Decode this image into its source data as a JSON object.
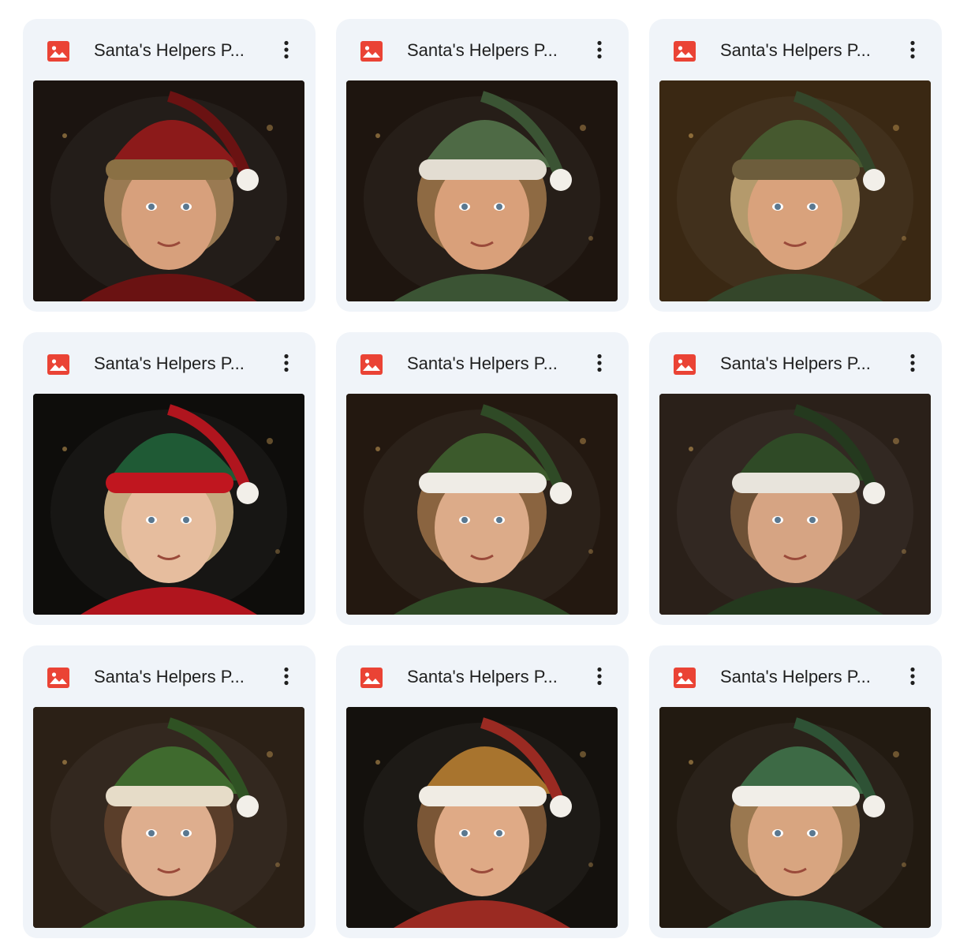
{
  "files": [
    {
      "name": "Santa's Helpers P...",
      "type_icon": "image-file-icon",
      "menu_icon": "more-vert-icon",
      "thumbnail": "santa-with-girl",
      "bg": "#1b1410",
      "hat": "#8c1a1a",
      "hat2": "#6a1212",
      "trim": "#8a7044",
      "hair": "#9a7a52",
      "skin": "#d7a07c"
    },
    {
      "name": "Santa's Helpers P...",
      "type_icon": "image-file-icon",
      "menu_icon": "more-vert-icon",
      "thumbnail": "elf-boy-green-white-hat",
      "bg": "#1e150f",
      "hat": "#4e6a45",
      "hat2": "#3b5434",
      "trim": "#e3ddd2",
      "hair": "#8e6a43",
      "skin": "#d9a07a"
    },
    {
      "name": "Santa's Helpers P...",
      "type_icon": "image-file-icon",
      "menu_icon": "more-vert-icon",
      "thumbnail": "elf-boy-stars-background",
      "bg": "#3a2813",
      "hat": "#46592f",
      "hat2": "#34462a",
      "trim": "#6d5d3c",
      "hair": "#b49a6c",
      "skin": "#d9a27c"
    },
    {
      "name": "Santa's Helpers P...",
      "type_icon": "image-file-icon",
      "menu_icon": "more-vert-icon",
      "thumbnail": "elf-girl-red-green-hat",
      "bg": "#0e0d0b",
      "hat": "#1f5a35",
      "hat2": "#b0151e",
      "trim": "#c0161f",
      "hair": "#c5ab80",
      "skin": "#e6bd9e"
    },
    {
      "name": "Santa's Helpers P...",
      "type_icon": "image-file-icon",
      "menu_icon": "more-vert-icon",
      "thumbnail": "elf-boy-pompom-hat",
      "bg": "#231810",
      "hat": "#3c5a2c",
      "hat2": "#2f4a26",
      "trim": "#efece6",
      "hair": "#8a6440",
      "skin": "#dcab89"
    },
    {
      "name": "Santa's Helpers P...",
      "type_icon": "image-file-icon",
      "menu_icon": "more-vert-icon",
      "thumbnail": "boy-holly-wreath",
      "bg": "#2a2019",
      "hat": "#2f4a26",
      "hat2": "#24391e",
      "trim": "#e8e4dc",
      "hair": "#6e5136",
      "skin": "#d6a483"
    },
    {
      "name": "Santa's Helpers P...",
      "type_icon": "image-file-icon",
      "menu_icon": "more-vert-icon",
      "thumbnail": "toddler-green-hood",
      "bg": "#2b2016",
      "hat": "#3f6a2e",
      "hat2": "#2f5223",
      "trim": "#e6dcc8",
      "hair": "#5a3e2a",
      "skin": "#deae8e"
    },
    {
      "name": "Santa's Helpers P...",
      "type_icon": "image-file-icon",
      "menu_icon": "more-vert-icon",
      "thumbnail": "boy-gold-red-hat-tree",
      "bg": "#14110d",
      "hat": "#a8742e",
      "hat2": "#9a2a22",
      "trim": "#f0ece4",
      "hair": "#7a5636",
      "skin": "#dfaa86"
    },
    {
      "name": "Santa's Helpers P...",
      "type_icon": "image-file-icon",
      "menu_icon": "more-vert-icon",
      "thumbnail": "boy-green-hat-snowflake",
      "bg": "#221a11",
      "hat": "#3d6a45",
      "hat2": "#2e5235",
      "trim": "#f1eee8",
      "hair": "#9a7850",
      "skin": "#d8a580"
    }
  ]
}
